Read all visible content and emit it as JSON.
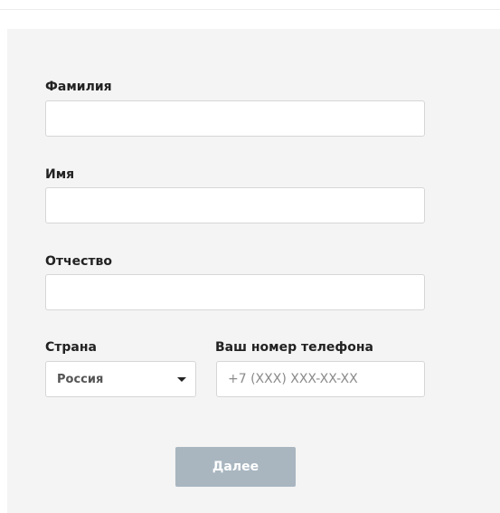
{
  "form": {
    "last_name": {
      "label": "Фамилия",
      "value": ""
    },
    "first_name": {
      "label": "Имя",
      "value": ""
    },
    "middle_name": {
      "label": "Отчество",
      "value": ""
    },
    "country": {
      "label": "Страна",
      "selected": "Россия",
      "icon": "caret-down-icon"
    },
    "phone": {
      "label": "Ваш номер телефона",
      "placeholder": "+7 (XXX) XXX-XX-XX",
      "value": ""
    },
    "submit_label": "Далее"
  },
  "colors": {
    "panel_background": "#f4f4f4",
    "button_background": "#a9b6c0",
    "input_border": "#d6d6d6"
  }
}
